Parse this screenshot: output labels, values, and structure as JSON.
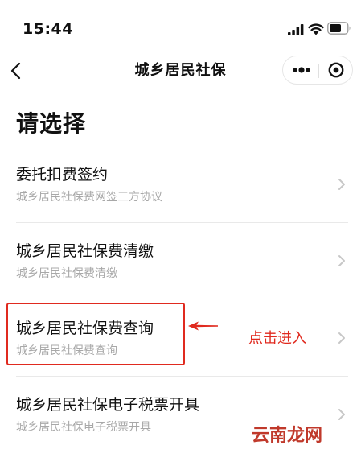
{
  "status_bar": {
    "time": "15:44",
    "icons": [
      "signal-icon",
      "wifi-icon",
      "battery-icon"
    ]
  },
  "nav": {
    "title": "城乡居民社保",
    "back_icon": "chevron-left-icon",
    "more_icon": "more-dots-icon",
    "close_icon": "target-circle-icon"
  },
  "heading": "请选择",
  "items": [
    {
      "title": "委托扣费签约",
      "subtitle": "城乡居民社保费网签三方协议"
    },
    {
      "title": "城乡居民社保费清缴",
      "subtitle": "城乡居民社保费清缴"
    },
    {
      "title": "城乡居民社保费查询",
      "subtitle": "城乡居民社保费查询"
    },
    {
      "title": "城乡居民社保电子税票开具",
      "subtitle": "城乡居民社保电子税票开具"
    }
  ],
  "annotation": {
    "text": "点击进入",
    "color": "#e02a1f",
    "arrow_icon": "arrow-left-icon"
  },
  "watermark": {
    "text": "云南龙网",
    "color": "#c0392b"
  },
  "colors": {
    "text": "#111111",
    "subtext": "#a8a8a8",
    "divider": "#e9e9e9",
    "chevron": "#c7c7c7"
  }
}
